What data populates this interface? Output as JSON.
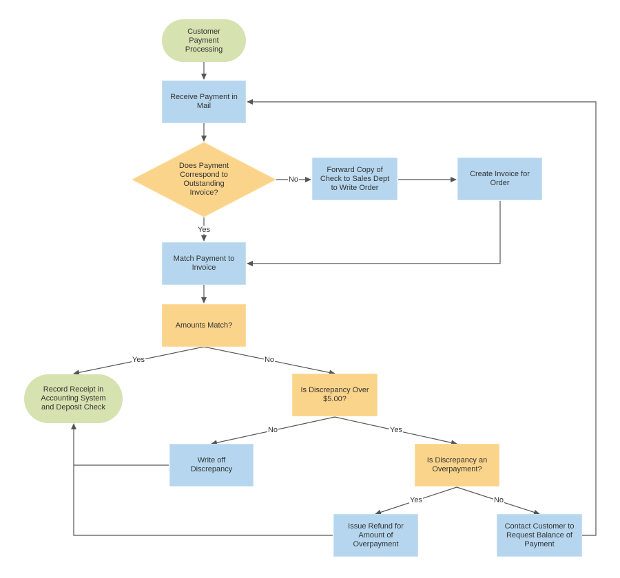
{
  "diagram": {
    "colors": {
      "terminal": "#d6e2b0",
      "process": "#b5d6ee",
      "decision": "#fbd48b",
      "edge": "#555555",
      "text": "#333333"
    },
    "nodes": {
      "start": {
        "type": "terminal",
        "label": "Customer Payment Processing"
      },
      "receive_payment": {
        "type": "process",
        "label": "Receive Payment in Mail"
      },
      "corresponds_invoice": {
        "type": "decision",
        "label": "Does Payment Correspond to Outstanding Invoice?"
      },
      "forward_copy": {
        "type": "process",
        "label": "Forward Copy of Check to Sales Dept to Write Order"
      },
      "create_invoice": {
        "type": "process",
        "label": "Create Invoice for Order"
      },
      "match_payment": {
        "type": "process",
        "label": "Match Payment to Invoice"
      },
      "amounts_match": {
        "type": "decision",
        "label": "Amounts Match?"
      },
      "record_receipt": {
        "type": "terminal",
        "label": "Record Receipt in Accounting System and Deposit Check"
      },
      "discrepancy_over": {
        "type": "decision",
        "label": "Is Discrepancy Over $5.00?"
      },
      "write_off": {
        "type": "process",
        "label": "Write off Discrepancy"
      },
      "is_overpayment": {
        "type": "decision",
        "label": "Is Discrepancy an Overpayment?"
      },
      "issue_refund": {
        "type": "process",
        "label": "Issue Refund for Amount of Overpayment"
      },
      "contact_customer": {
        "type": "process",
        "label": "Contact Customer to Request Balance of Payment"
      }
    },
    "edges": [
      {
        "from": "start",
        "to": "receive_payment",
        "label": ""
      },
      {
        "from": "receive_payment",
        "to": "corresponds_invoice",
        "label": ""
      },
      {
        "from": "corresponds_invoice",
        "to": "forward_copy",
        "label": "No"
      },
      {
        "from": "corresponds_invoice",
        "to": "match_payment",
        "label": "Yes"
      },
      {
        "from": "forward_copy",
        "to": "create_invoice",
        "label": ""
      },
      {
        "from": "create_invoice",
        "to": "match_payment",
        "label": ""
      },
      {
        "from": "match_payment",
        "to": "amounts_match",
        "label": ""
      },
      {
        "from": "amounts_match",
        "to": "record_receipt",
        "label": "Yes"
      },
      {
        "from": "amounts_match",
        "to": "discrepancy_over",
        "label": "No"
      },
      {
        "from": "discrepancy_over",
        "to": "write_off",
        "label": "No"
      },
      {
        "from": "discrepancy_over",
        "to": "is_overpayment",
        "label": "Yes"
      },
      {
        "from": "is_overpayment",
        "to": "issue_refund",
        "label": "Yes"
      },
      {
        "from": "is_overpayment",
        "to": "contact_customer",
        "label": "No"
      },
      {
        "from": "write_off",
        "to": "record_receipt",
        "label": ""
      },
      {
        "from": "issue_refund",
        "to": "record_receipt",
        "label": ""
      },
      {
        "from": "contact_customer",
        "to": "receive_payment",
        "label": ""
      }
    ]
  }
}
